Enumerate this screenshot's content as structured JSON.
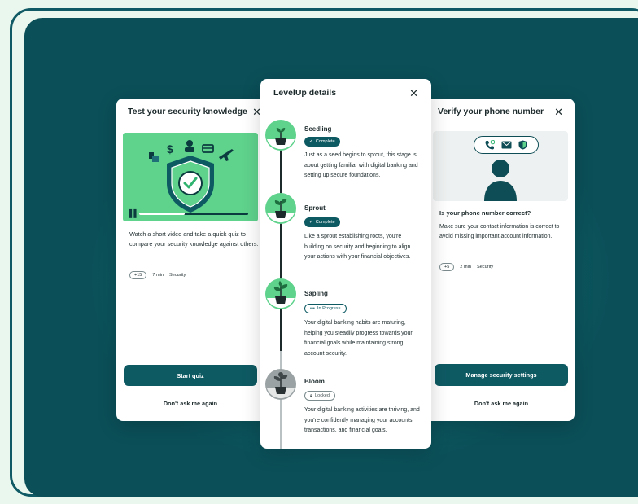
{
  "left_card": {
    "title": "Test your security knowledge",
    "close": "✕",
    "description": "Watch a short video and take a quick quiz to compare your security knowledge against others.",
    "points": "+15",
    "duration": "7 min",
    "category": "Security",
    "primary_button": "Start quiz",
    "secondary_button": "Don't ask me again",
    "video_progress": 0.42
  },
  "middle_card": {
    "title": "LevelUp details",
    "close": "✕",
    "stages": [
      {
        "name": "Seedling",
        "status": "Complete",
        "status_icon": "check-icon",
        "description": "Just as a seed begins to sprout, this stage is about getting familiar with digital banking and setting up secure foundations."
      },
      {
        "name": "Sprout",
        "status": "Complete",
        "status_icon": "check-icon",
        "description": "Like a sprout establishing roots, you're building on security and beginning to align your actions with your financial objectives."
      },
      {
        "name": "Sapling",
        "status": "In Progress",
        "status_icon": "dots-icon",
        "description": "Your digital banking habits are maturing, helping you steadily progress towards your financial goals while maintaining strong account security."
      },
      {
        "name": "Bloom",
        "status": "Locked",
        "status_icon": "lock-icon",
        "description": "Your digital banking activities are thriving, and you're confidently managing your accounts, transactions, and financial goals."
      }
    ]
  },
  "right_card": {
    "title": "Verify your phone number",
    "close": "✕",
    "question": "Is your phone number correct?",
    "description": "Make sure your contact information is correct to avoid missing important account information.",
    "points": "+5",
    "duration": "2 min",
    "category": "Security",
    "primary_button": "Manage security settings",
    "secondary_button": "Don't ask me again"
  },
  "colors": {
    "brand_dark": "#0e5a63",
    "brand_green": "#5fd28c",
    "background_light": "#e9f7ee"
  }
}
